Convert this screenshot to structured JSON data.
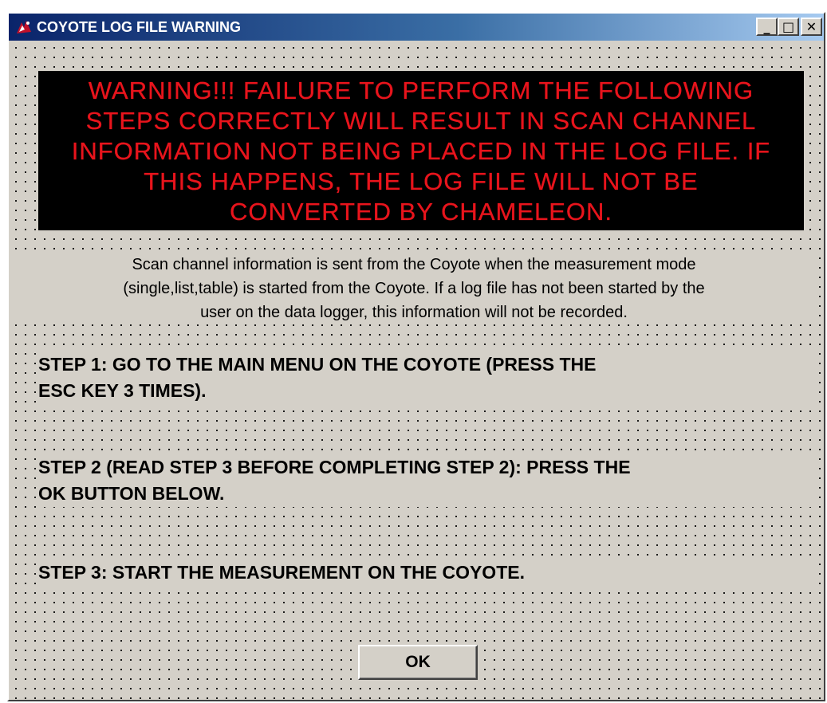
{
  "window": {
    "title": "COYOTE LOG FILE WARNING",
    "app_icon": "coyote-app-icon",
    "minimize_glyph": "_",
    "maximize_glyph": "□",
    "close_glyph": "✕"
  },
  "warning": {
    "lines": [
      "WARNING!!! FAILURE TO PERFORM THE FOLLOWING",
      "STEPS CORRECTLY WILL RESULT IN SCAN CHANNEL",
      "INFORMATION NOT BEING PLACED IN THE LOG FILE. IF",
      "THIS HAPPENS, THE LOG FILE WILL NOT BE",
      "CONVERTED BY CHAMELEON."
    ],
    "text_color": "#e8141c",
    "background_color": "#000000"
  },
  "info": {
    "lines": [
      "Scan channel information is sent from the Coyote when the measurement mode",
      "(single,list,table) is started from the Coyote. If a log file has not been started by the",
      "user on the data logger, this information will not be recorded."
    ]
  },
  "steps": {
    "step1": [
      "STEP 1: GO TO THE MAIN MENU ON THE COYOTE (PRESS THE",
      "ESC KEY 3 TIMES)."
    ],
    "step2": [
      "STEP 2 (READ STEP 3 BEFORE COMPLETING STEP 2): PRESS THE",
      "OK BUTTON BELOW."
    ],
    "step3": [
      "STEP 3: START THE MEASUREMENT ON THE COYOTE."
    ]
  },
  "buttons": {
    "ok_label": "OK"
  }
}
